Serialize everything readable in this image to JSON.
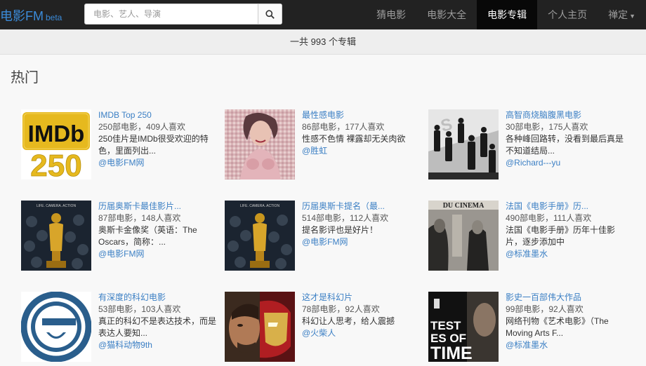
{
  "nav": {
    "brand": "电影FM",
    "beta": "beta",
    "search_placeholder": "电影、艺人、导演",
    "links": [
      "猜电影",
      "电影大全",
      "电影专辑",
      "个人主页",
      "禅定"
    ]
  },
  "count_text": "一共 993 个专辑",
  "section_title": "热门",
  "albums": [
    {
      "title": "IMDB Top 250",
      "stats": "250部电影，409人喜欢",
      "desc": "250佳片是IMDb很受欢迎的特色，里面列出...",
      "author": "@电影FM网"
    },
    {
      "title": "最性感电影",
      "stats": "86部电影，177人喜欢",
      "desc": "性感不色情 裸露却无关肉欲",
      "author": "@胜虹"
    },
    {
      "title": "高智商烧脑腹黑电影",
      "stats": "30部电影，175人喜欢",
      "desc": "各种峰回路转，没看到最后真是不知道结局...",
      "author": "@Richard---yu"
    },
    {
      "title": "历届奥斯卡最佳影片...",
      "stats": "87部电影，148人喜欢",
      "desc": "奥斯卡金像奖（英语：The Oscars，简称：...",
      "author": "@电影FM网"
    },
    {
      "title": "历届奥斯卡提名（最...",
      "stats": "514部电影，112人喜欢",
      "desc": "提名影评也是好片！",
      "author": "@电影FM网"
    },
    {
      "title": "法国《电影手册》历...",
      "stats": "490部电影，111人喜欢",
      "desc": "法国《电影手册》历年十佳影片，逐步添加中",
      "author": "@标准墨水"
    },
    {
      "title": "有深度的科幻电影",
      "stats": "53部电影，103人喜欢",
      "desc": "真正的科幻不是表达技术，而是表达人要知...",
      "author": "@猫科动物9th"
    },
    {
      "title": "这才是科幻片",
      "stats": "78部电影，92人喜欢",
      "desc": "科幻让人思考，给人震撼",
      "author": "@火柴人"
    },
    {
      "title": "影史一百部伟大作品",
      "stats": "99部电影，92人喜欢",
      "desc": "网络刊物《艺术电影》（The Moving Arts F...",
      "author": "@标准墨水"
    }
  ],
  "covers": {
    "imdb": {
      "line1": "IMDb",
      "line2": "250"
    },
    "oscar_header": "LIFE. CAMERA. ACTION",
    "cinema_header": "DU CINEMA",
    "time_text": {
      "line1": "TEST",
      "line2": "ES OF",
      "line3": "TIME"
    }
  },
  "colors": {
    "navbar": "#222222",
    "link": "#3b7fc4",
    "brand": "#3b8bd9",
    "active_nav": "#080808"
  }
}
